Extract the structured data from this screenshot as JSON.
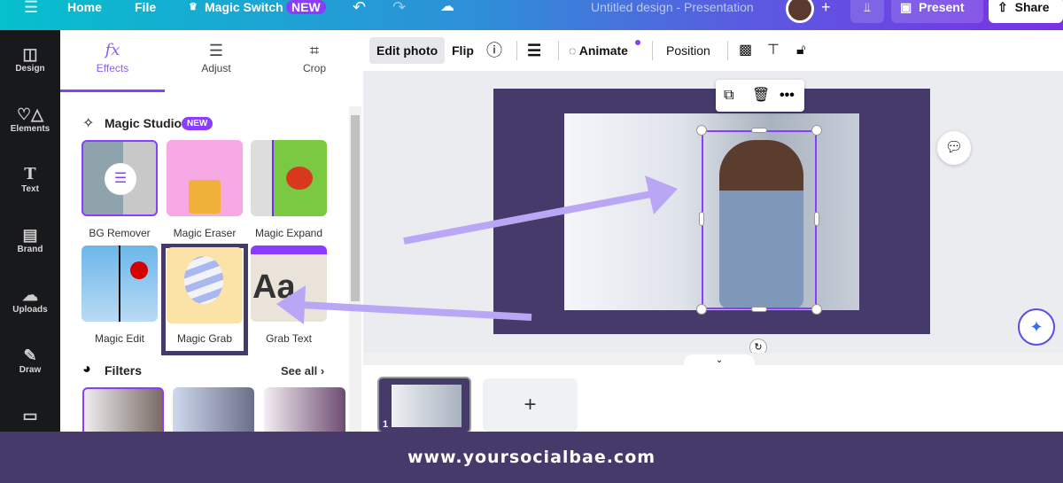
{
  "topbar": {
    "home": "Home",
    "file": "File",
    "magic_switch": "Magic Switch",
    "new_badge": "NEW",
    "title": "Untitled design - Presentation",
    "present": "Present",
    "share": "Share"
  },
  "rail": [
    {
      "label": "Design"
    },
    {
      "label": "Elements"
    },
    {
      "label": "Text"
    },
    {
      "label": "Brand"
    },
    {
      "label": "Uploads"
    },
    {
      "label": "Draw"
    }
  ],
  "panel": {
    "tabs": [
      {
        "label": "Effects",
        "icon": "fx"
      },
      {
        "label": "Adjust"
      },
      {
        "label": "Crop"
      }
    ],
    "magic_studio": {
      "title": "Magic Studio",
      "badge": "NEW",
      "tools": [
        {
          "label": "BG Remover"
        },
        {
          "label": "Magic Eraser"
        },
        {
          "label": "Magic Expand"
        },
        {
          "label": "Magic Edit"
        },
        {
          "label": "Magic Grab"
        },
        {
          "label": "Grab Text",
          "tile_text": "Aa"
        }
      ]
    },
    "filters": {
      "title": "Filters",
      "see_all": "See all"
    }
  },
  "toolbar": {
    "edit_photo": "Edit photo",
    "flip": "Flip",
    "animate": "Animate",
    "position": "Position"
  },
  "pages": {
    "current": "1",
    "add": "+"
  },
  "footer": {
    "text": "www.yoursocialbae.com"
  },
  "colors": {
    "accent": "#8b3dff",
    "brand_purple": "#463a6b",
    "arrow": "#b9a6f5"
  }
}
